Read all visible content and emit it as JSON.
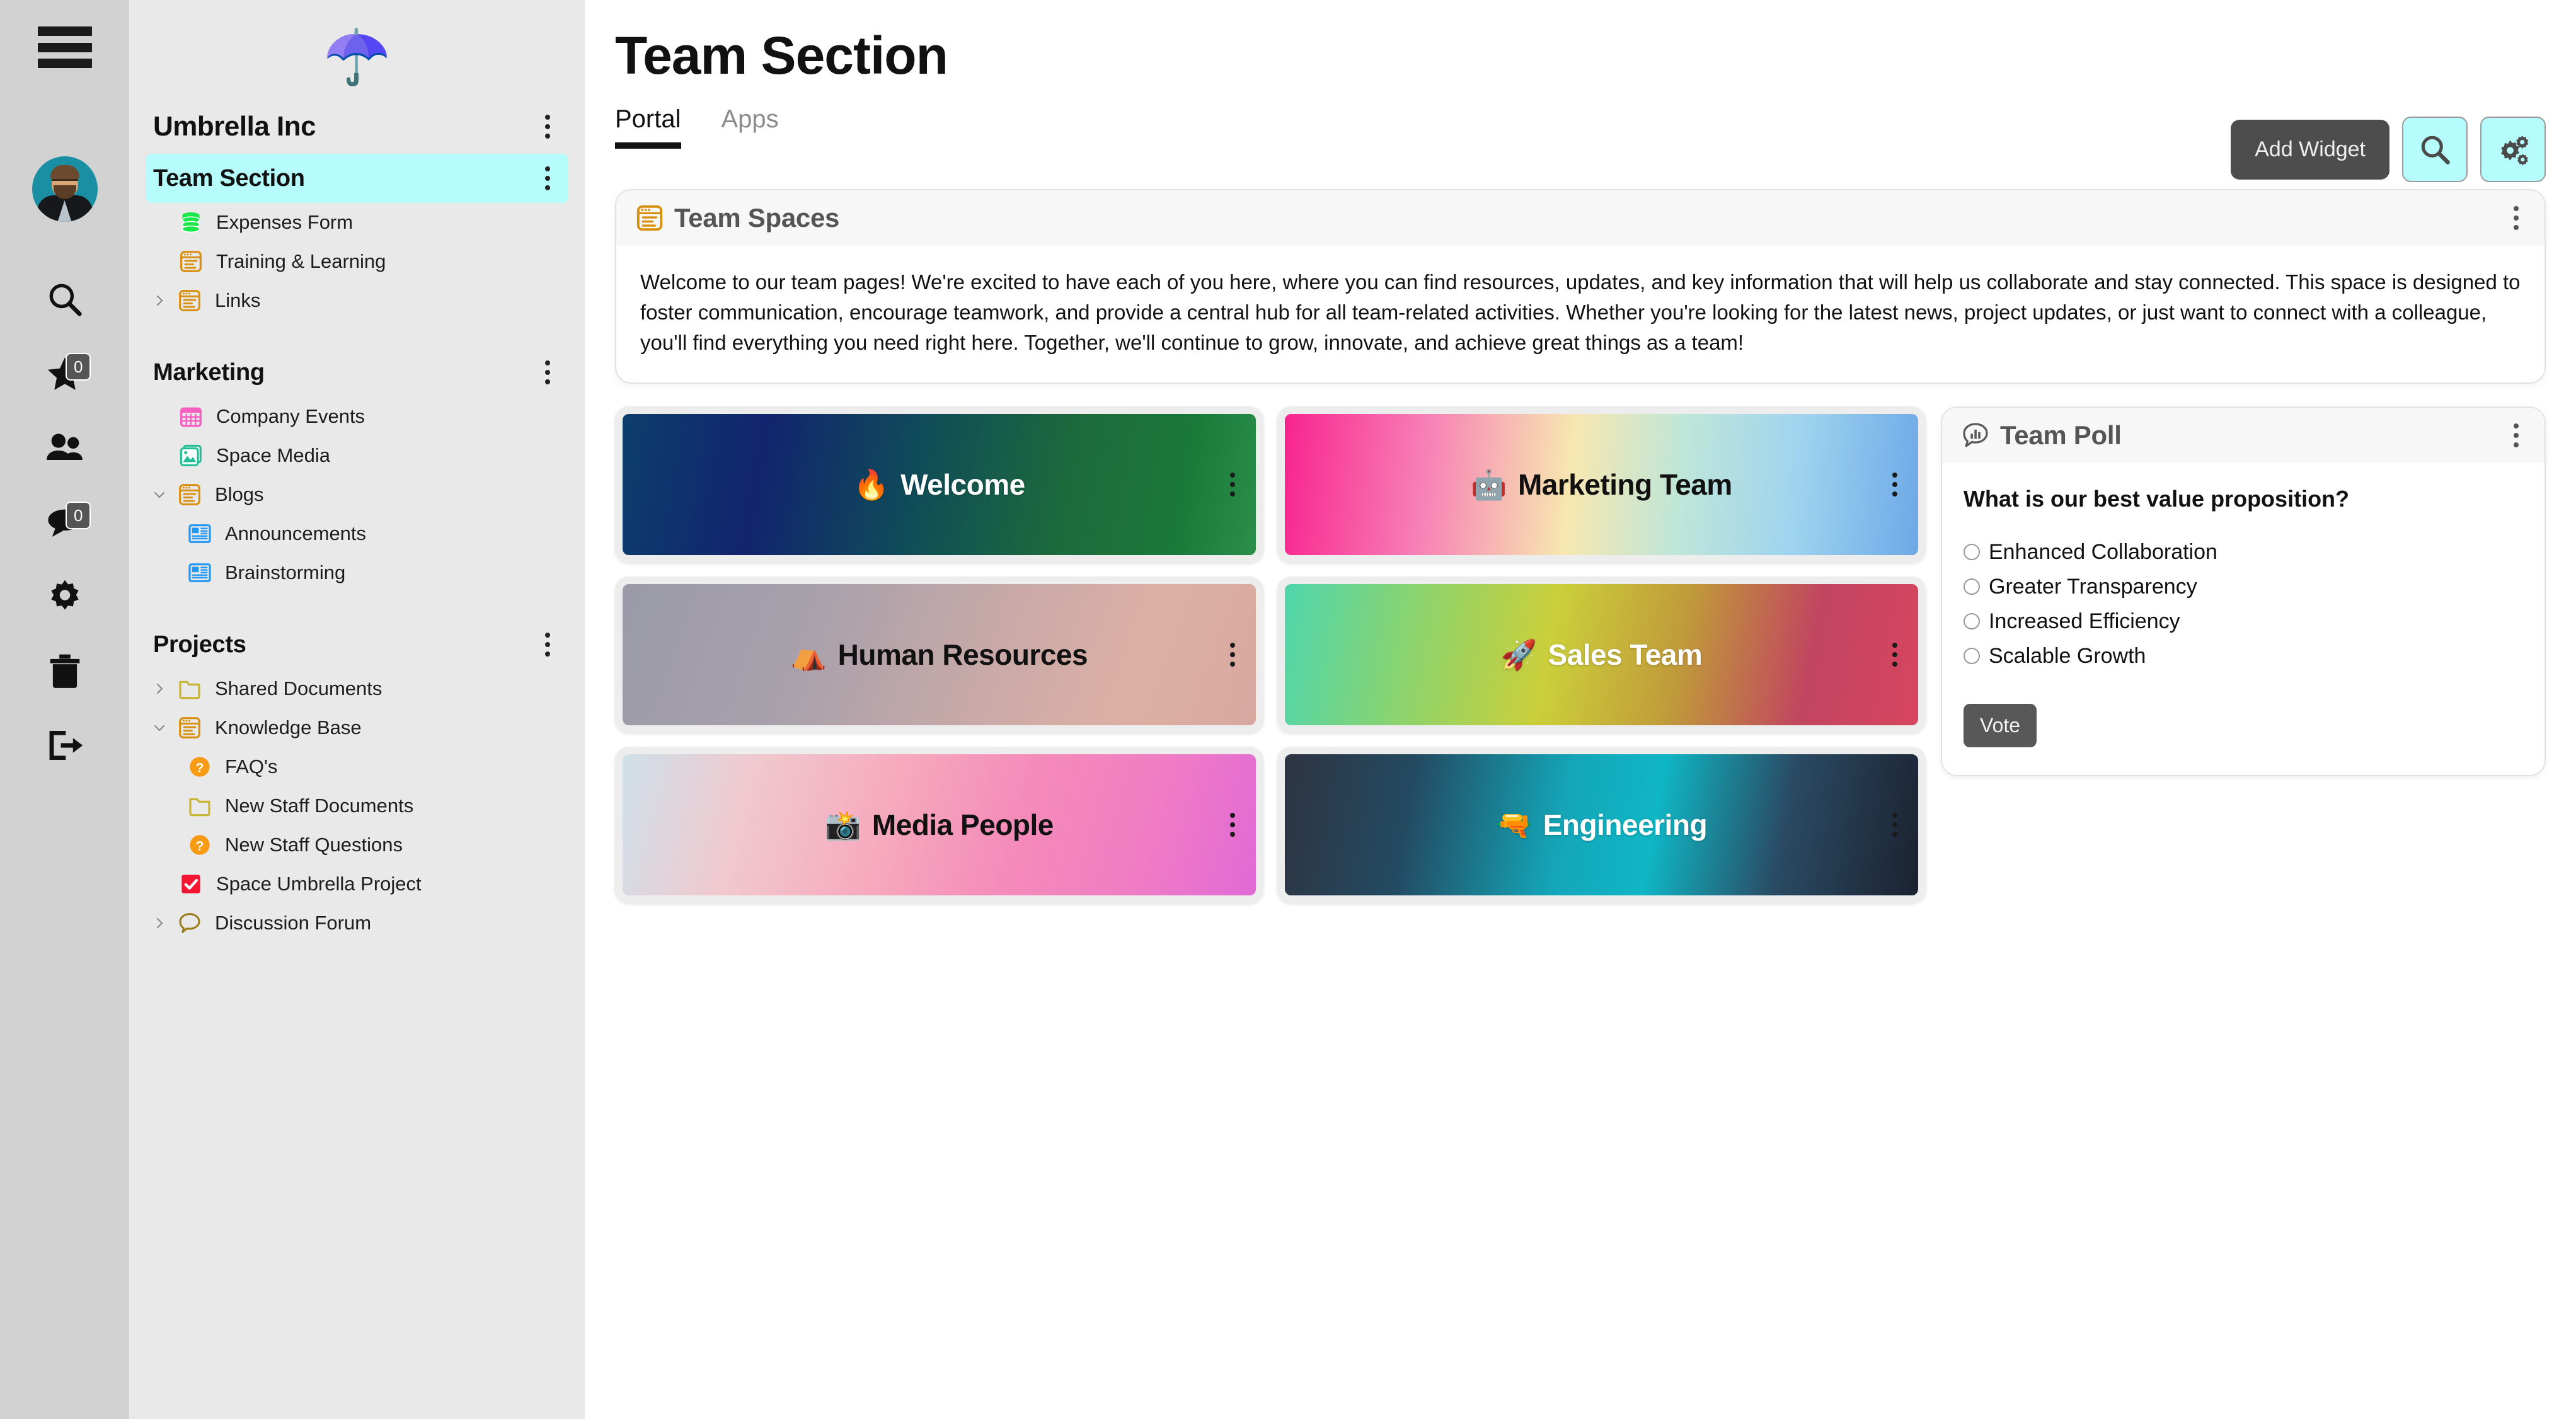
{
  "rail": {
    "hamburger_label": "menu-toggle",
    "items": [
      {
        "icon": "search-icon",
        "badge": null
      },
      {
        "icon": "star-icon",
        "badge": "0"
      },
      {
        "icon": "people-icon",
        "badge": null
      },
      {
        "icon": "chat-bubble-icon",
        "badge": "0"
      },
      {
        "icon": "gear-icon",
        "badge": null
      },
      {
        "icon": "trash-icon",
        "badge": null
      },
      {
        "icon": "logout-icon",
        "badge": null
      }
    ]
  },
  "sidebar": {
    "logo_emoji": "☂️",
    "org_name": "Umbrella Inc",
    "sections": [
      {
        "title": "Team Section",
        "active": true,
        "items": [
          {
            "label": "Expenses Form",
            "icon": "database-icon",
            "caret": null,
            "indent": 0
          },
          {
            "label": "Training & Learning",
            "icon": "page-icon",
            "caret": null,
            "indent": 0
          },
          {
            "label": "Links",
            "icon": "page-icon",
            "caret": "right",
            "indent": 0
          }
        ]
      },
      {
        "title": "Marketing",
        "active": false,
        "items": [
          {
            "label": "Company Events",
            "icon": "calendar-icon",
            "caret": null,
            "indent": 0
          },
          {
            "label": "Space Media",
            "icon": "media-icon",
            "caret": null,
            "indent": 0
          },
          {
            "label": "Blogs",
            "icon": "page-icon",
            "caret": "down",
            "indent": 0
          },
          {
            "label": "Announcements",
            "icon": "news-icon",
            "caret": null,
            "indent": 1
          },
          {
            "label": "Brainstorming",
            "icon": "news-icon",
            "caret": null,
            "indent": 1
          }
        ]
      },
      {
        "title": "Projects",
        "active": false,
        "items": [
          {
            "label": "Shared Documents",
            "icon": "folder-icon",
            "caret": "right",
            "indent": 0
          },
          {
            "label": "Knowledge Base",
            "icon": "page-icon",
            "caret": "down",
            "indent": 0
          },
          {
            "label": "FAQ's",
            "icon": "question-icon",
            "caret": null,
            "indent": 1
          },
          {
            "label": "New Staff Documents",
            "icon": "folder-icon",
            "caret": null,
            "indent": 1
          },
          {
            "label": "New Staff Questions",
            "icon": "question-icon",
            "caret": null,
            "indent": 1
          },
          {
            "label": "Space Umbrella Project",
            "icon": "checkbox-icon",
            "caret": null,
            "indent": 0
          },
          {
            "label": "Discussion Forum",
            "icon": "speech-icon",
            "caret": "right",
            "indent": 0
          }
        ]
      }
    ]
  },
  "main": {
    "page_title": "Team Section",
    "tabs": [
      {
        "label": "Portal",
        "active": true
      },
      {
        "label": "Apps",
        "active": false
      }
    ],
    "actions": {
      "add_widget_label": "Add Widget",
      "search_icon": "search-icon",
      "settings_icon": "gears-icon"
    },
    "team_spaces": {
      "title": "Team Spaces",
      "icon": "page-icon",
      "welcome_text": "Welcome to our team pages! We're excited to have each of you here, where you can find resources, updates, and key information that will help us collaborate and stay connected. This space is designed to foster communication, encourage teamwork, and provide a central hub for all team-related activities. Whether you're looking for the latest news, project updates, or just want to connect with a colleague, you'll find everything you need right here. Together, we'll continue to grow, innovate, and achieve great things as a team!"
    },
    "tiles": [
      {
        "label": "Welcome",
        "emoji": "🔥",
        "text_color": "white",
        "theme": "t-welcome"
      },
      {
        "label": "Marketing Team",
        "emoji": "🤖",
        "text_color": "black",
        "theme": "t-marketing"
      },
      {
        "label": "Human Resources",
        "emoji": "⛺",
        "text_color": "black",
        "theme": "t-hr"
      },
      {
        "label": "Sales Team",
        "emoji": "🚀",
        "text_color": "white",
        "theme": "t-sales"
      },
      {
        "label": "Media People",
        "emoji": "📸",
        "text_color": "black",
        "theme": "t-media"
      },
      {
        "label": "Engineering",
        "emoji": "🔫",
        "text_color": "white",
        "theme": "t-eng"
      }
    ],
    "poll": {
      "title": "Team Poll",
      "icon": "poll-bubble-icon",
      "question": "What is our best value proposition?",
      "options": [
        "Enhanced Collaboration",
        "Greater Transparency",
        "Increased Efficiency",
        "Scalable Growth"
      ],
      "vote_label": "Vote"
    }
  },
  "colors": {
    "accent_cyan": "#b6fcfc",
    "rail_bg": "#d2d2d2",
    "sidebar_bg": "#e9e9e9",
    "dark_button": "#4d4d4d",
    "icon_orange": "#d9900f"
  }
}
